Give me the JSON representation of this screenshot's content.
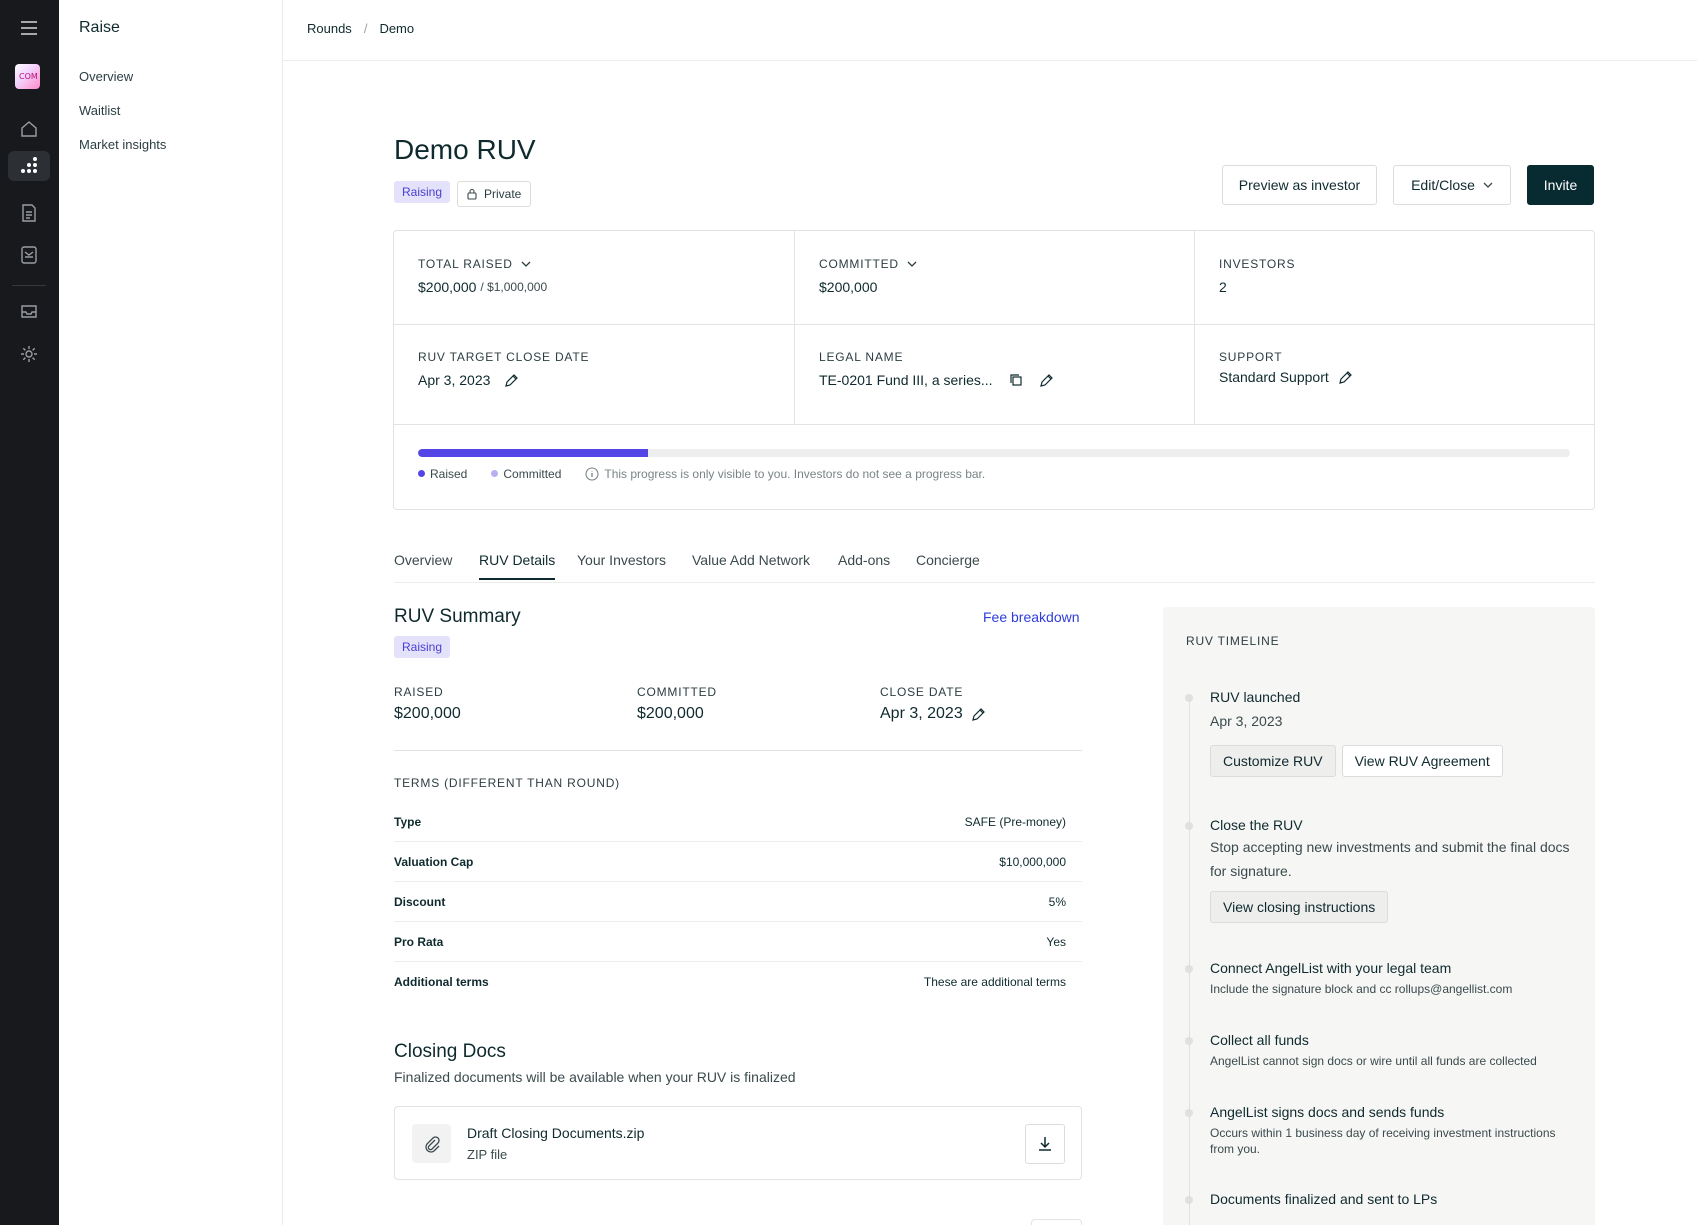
{
  "sidebar": {
    "title": "Raise",
    "items": [
      {
        "label": "Overview"
      },
      {
        "label": "Waitlist"
      },
      {
        "label": "Market insights"
      }
    ]
  },
  "breadcrumb": [
    "Rounds",
    "Demo"
  ],
  "header": {
    "title": "Demo RUV",
    "status_badge": "Raising",
    "privacy_badge": "Private",
    "preview_label": "Preview as investor",
    "edit_label": "Edit/Close",
    "invite_label": "Invite"
  },
  "stats": {
    "total_raised": {
      "label": "TOTAL RAISED",
      "value": "$200,000",
      "target": "/ $1,000,000"
    },
    "committed": {
      "label": "COMMITTED",
      "value": "$200,000"
    },
    "investors": {
      "label": "INVESTORS",
      "value": "2"
    },
    "target_close": {
      "label": "RUV TARGET CLOSE DATE",
      "value": "Apr 3, 2023"
    },
    "legal_name": {
      "label": "LEGAL NAME",
      "value": "TE-0201 Fund III, a series..."
    },
    "support": {
      "label": "SUPPORT",
      "value": "Standard Support"
    },
    "progress": {
      "raised_fraction": 0.2,
      "legend_raised": "Raised",
      "legend_committed": "Committed",
      "note": "This progress is only visible to you. Investors do not see a progress bar."
    }
  },
  "tabs": [
    {
      "label": "Overview"
    },
    {
      "label": "RUV Details",
      "active": true
    },
    {
      "label": "Your Investors"
    },
    {
      "label": "Value Add Network"
    },
    {
      "label": "Add-ons"
    },
    {
      "label": "Concierge"
    }
  ],
  "summary": {
    "title": "RUV Summary",
    "badge": "Raising",
    "fee_link": "Fee breakdown",
    "raised_label": "RAISED",
    "raised_value": "$200,000",
    "committed_label": "COMMITTED",
    "committed_value": "$200,000",
    "close_label": "CLOSE DATE",
    "close_value": "Apr 3, 2023"
  },
  "terms": {
    "label": "TERMS (DIFFERENT THAN ROUND)",
    "rows": [
      {
        "k": "Type",
        "v": "SAFE (Pre-money)"
      },
      {
        "k": "Valuation Cap",
        "v": "$10,000,000"
      },
      {
        "k": "Discount",
        "v": "5%"
      },
      {
        "k": "Pro Rata",
        "v": "Yes"
      },
      {
        "k": "Additional terms",
        "v": "These are additional terms"
      }
    ]
  },
  "docs": {
    "title": "Closing Docs",
    "subtitle": "Finalized documents will be available when your RUV is finalized",
    "file_name": "Draft Closing Documents.zip",
    "file_type": "ZIP file"
  },
  "timeline": {
    "title": "RUV TIMELINE",
    "steps": [
      {
        "title": "RUV launched",
        "desc": "Apr 3, 2023",
        "buttons": [
          "Customize RUV",
          "View RUV Agreement"
        ]
      },
      {
        "title": "Close the RUV",
        "desc": "Stop accepting new investments and submit the final docs for signature.",
        "buttons": [
          "View closing instructions"
        ]
      },
      {
        "title": "Connect AngelList with your legal team",
        "desc": "Include the signature block and cc rollups@angellist.com"
      },
      {
        "title": "Collect all funds",
        "desc": "AngelList cannot sign docs or wire until all funds are collected"
      },
      {
        "title": "AngelList signs docs and sends funds",
        "desc": "Occurs within 1 business day of receiving investment instructions from you."
      },
      {
        "title": "Documents finalized and sent to LPs"
      }
    ]
  },
  "colors": {
    "accent": "#5446e6",
    "link": "#2f3ed9",
    "primary_button": "#072b30",
    "rail": "#17191c",
    "badge_bg": "#e4e1fb"
  }
}
